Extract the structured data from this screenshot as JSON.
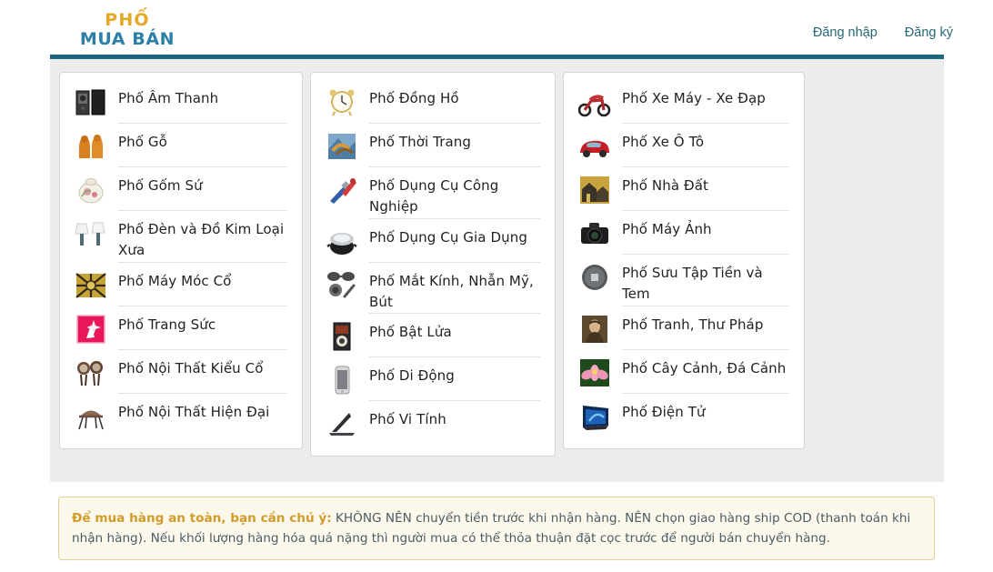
{
  "header": {
    "logo_line1": "PHỐ",
    "logo_line2": "MUA BÁN",
    "logo_color_top": "#E5A824",
    "logo_color_bottom": "#2B7FA8",
    "links": [
      {
        "label": "Đăng nhập",
        "name": "login-link"
      },
      {
        "label": "Đăng ký",
        "name": "register-link"
      }
    ],
    "divider_color": "#1D6680"
  },
  "columns": [
    {
      "name": "category-column-1",
      "items": [
        {
          "label": "Phố Âm Thanh",
          "icon": "speaker-icon"
        },
        {
          "label": "Phố Gỗ",
          "icon": "wood-statue-icon"
        },
        {
          "label": "Phố Gốm Sứ",
          "icon": "ceramic-jar-icon"
        },
        {
          "label": "Phố Đèn và Đồ Kim Loại Xưa",
          "icon": "lamp-icon"
        },
        {
          "label": "Phố Máy Móc Cổ",
          "icon": "antique-machine-icon"
        },
        {
          "label": "Phố Trang Sức",
          "icon": "jewelry-icon"
        },
        {
          "label": "Phố Nội Thất Kiểu Cổ",
          "icon": "antique-furniture-icon"
        },
        {
          "label": "Phố Nội Thất Hiện Đại",
          "icon": "modern-chair-icon"
        }
      ]
    },
    {
      "name": "category-column-2",
      "items": [
        {
          "label": "Phố Đồng Hồ",
          "icon": "clock-icon"
        },
        {
          "label": "Phố Thời Trang",
          "icon": "fashion-icon"
        },
        {
          "label": "Phố Dụng Cụ Công Nghiệp",
          "icon": "tools-icon"
        },
        {
          "label": "Phố Dụng Cụ Gia Dụng",
          "icon": "pot-icon"
        },
        {
          "label": "Phố Mắt Kính, Nhẫn Mỹ, Bút",
          "icon": "sunglasses-icon"
        },
        {
          "label": "Phố Bật Lửa",
          "icon": "lighter-icon"
        },
        {
          "label": "Phố Di Động",
          "icon": "mobile-phone-icon"
        },
        {
          "label": "Phố Vi Tính",
          "icon": "laptop-icon"
        }
      ]
    },
    {
      "name": "category-column-3",
      "items": [
        {
          "label": "Phố Xe Máy - Xe Đạp",
          "icon": "motorbike-icon"
        },
        {
          "label": "Phố Xe Ô Tô",
          "icon": "car-icon"
        },
        {
          "label": "Phố Nhà Đất",
          "icon": "house-icon"
        },
        {
          "label": "Phố Máy Ảnh",
          "icon": "camera-icon"
        },
        {
          "label": "Phố Sưu Tập Tiền và Tem",
          "icon": "coin-icon"
        },
        {
          "label": "Phố Tranh, Thư Pháp",
          "icon": "painting-icon"
        },
        {
          "label": "Phố Cây Cảnh, Đá Cảnh",
          "icon": "lotus-icon"
        },
        {
          "label": "Phố Điện Tử",
          "icon": "tv-icon"
        }
      ]
    }
  ],
  "notice": {
    "strong": "Để mua hàng an toàn, bạn cần chú ý:",
    "rest": " KHÔNG NÊN chuyển tiền trước khi nhận hàng. NÊN chọn giao hàng ship COD (thanh toán khi nhận hàng). Nếu khối lượng hàng hóa quá nặng thì người mua có thể thỏa thuận đặt cọc trước để người bán chuyển hàng.",
    "bg_color": "#FDF8EC",
    "border_color": "#E3CE93",
    "strong_color": "#D19B28"
  }
}
